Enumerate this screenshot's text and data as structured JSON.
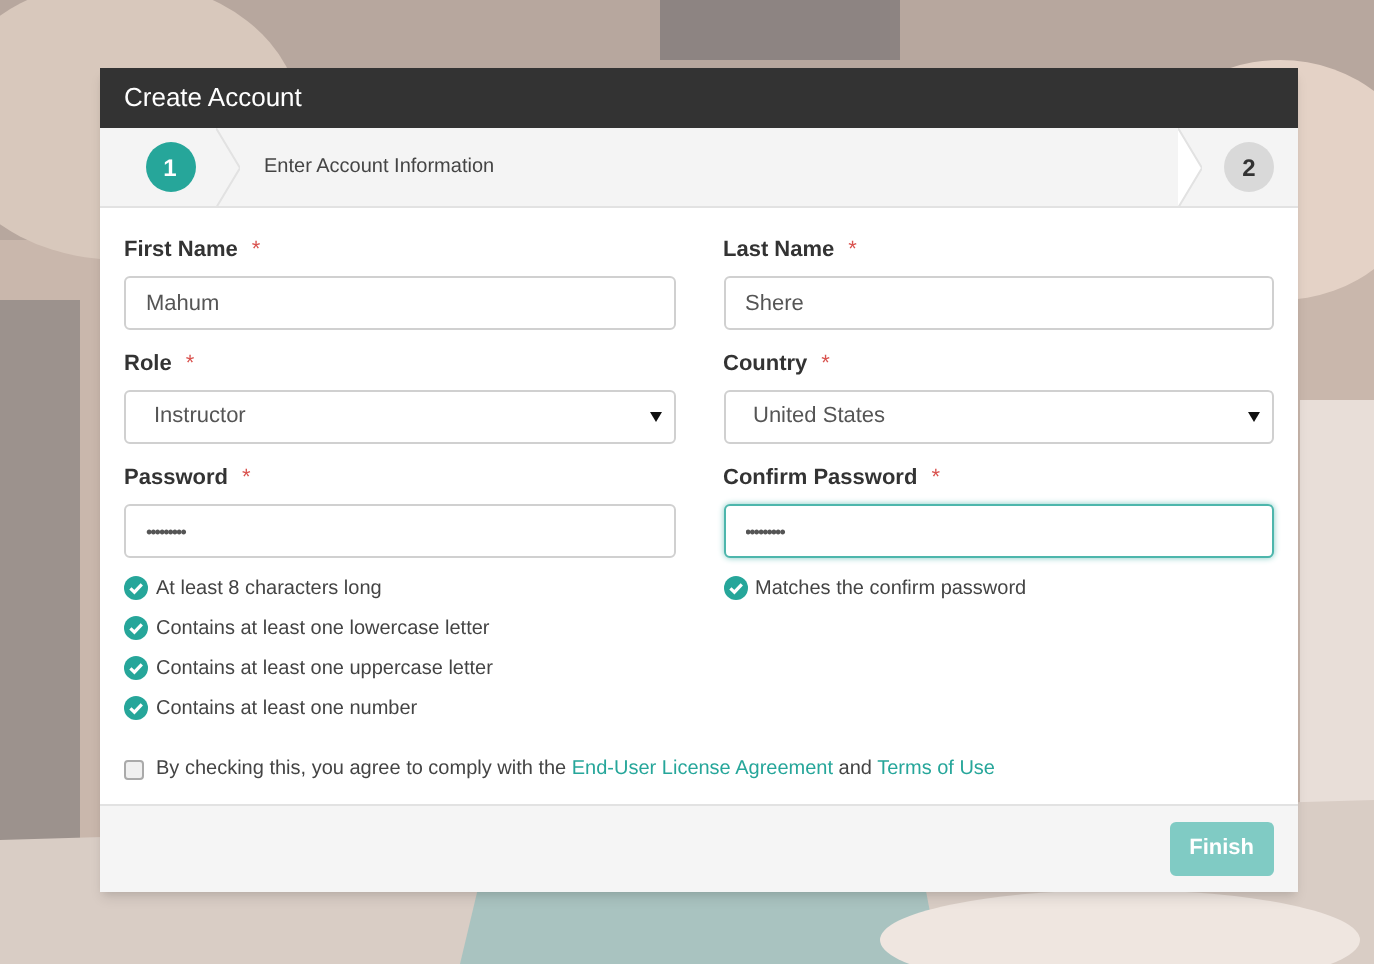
{
  "dialog": {
    "title": "Create Account"
  },
  "steps": [
    {
      "number": "1",
      "label": "Enter Account Information",
      "selected": true
    },
    {
      "number": "2",
      "selected": false
    }
  ],
  "fields": [
    {
      "kind": "text",
      "label": "First Name",
      "required_mark": "*",
      "value": "Mahum",
      "focused": false
    },
    {
      "kind": "text",
      "label": "Last Name",
      "required_mark": "*",
      "value": "Shere",
      "focused": false
    },
    {
      "kind": "select",
      "label": "Role",
      "required_mark": "*",
      "value": "Instructor",
      "focused": false
    },
    {
      "kind": "select",
      "label": "Country",
      "required_mark": "*",
      "value": "United States",
      "focused": false
    },
    {
      "kind": "password",
      "label": "Password",
      "required_mark": "*",
      "value": "•••••••••",
      "focused": false,
      "rules": [
        {
          "label": "At least 8 characters long",
          "met": true
        },
        {
          "label": "Contains at least one lowercase letter",
          "met": true
        },
        {
          "label": "Contains at least one uppercase letter",
          "met": true
        },
        {
          "label": "Contains at least one number",
          "met": true
        }
      ]
    },
    {
      "kind": "password",
      "label": "Confirm Password",
      "required_mark": "*",
      "value": "•••••••••",
      "focused": true,
      "rules": [
        {
          "label": "Matches the confirm password",
          "met": true
        }
      ]
    }
  ],
  "agreement": {
    "checked": false,
    "segments": [
      {
        "kind": "text",
        "text": "By checking this, you agree to comply with the"
      },
      {
        "kind": "link",
        "text": "End-User License Agreement"
      },
      {
        "kind": "text",
        "text": "and"
      },
      {
        "kind": "link",
        "text": "Terms of Use"
      }
    ]
  },
  "finish_button": {
    "label": "Finish",
    "disabled": true
  }
}
